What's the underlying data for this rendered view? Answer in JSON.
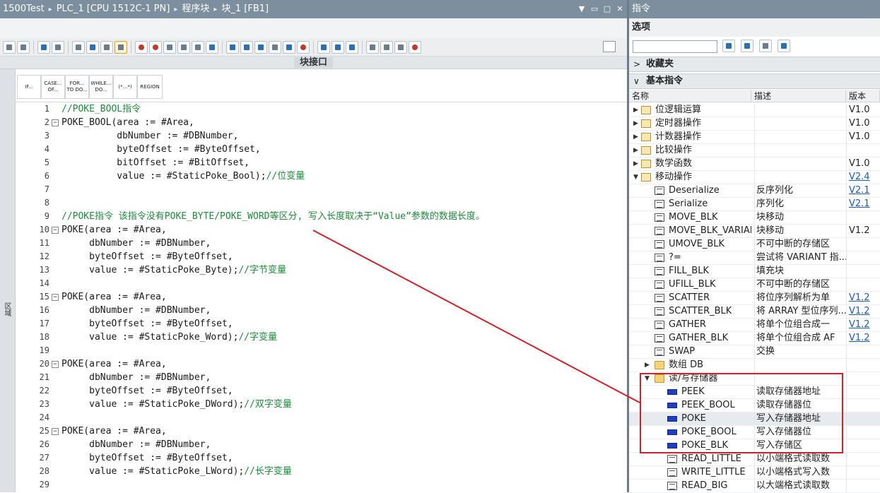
{
  "editor": {
    "breadcrumb": [
      "1500Test",
      "PLC_1 [CPU 1512C-1 PN]",
      "程序块",
      "块_1 [FB1]"
    ],
    "window_controls": [
      "▼",
      "▭",
      "□",
      "✕"
    ],
    "interface_label": "块接口",
    "side_label": "区域",
    "snippets": [
      "IF...",
      "CASE... OF...",
      "FOR... TO DO...",
      "WHILE... DO...",
      "(*...*)",
      "REGION"
    ],
    "lines": [
      {
        "n": "1",
        "fold": "",
        "code": "",
        "comment": "//POKE_BOOL指令"
      },
      {
        "n": "2",
        "fold": "−",
        "code": "POKE_BOOL(area := #Area,",
        "comment": ""
      },
      {
        "n": "3",
        "fold": "",
        "code": "          dbNumber := #DBNumber,",
        "comment": ""
      },
      {
        "n": "4",
        "fold": "",
        "code": "          byteOffset := #ByteOffset,",
        "comment": ""
      },
      {
        "n": "5",
        "fold": "",
        "code": "          bitOffset := #BitOffset,",
        "comment": ""
      },
      {
        "n": "6",
        "fold": "",
        "code": "          value := #StaticPoke_Bool);",
        "comment": "//位变量"
      },
      {
        "n": "7",
        "fold": "",
        "code": "",
        "comment": ""
      },
      {
        "n": "8",
        "fold": "",
        "code": "",
        "comment": ""
      },
      {
        "n": "9",
        "fold": "",
        "code": "",
        "comment": "//POKE指令 该指令没有POKE_BYTE/POKE_WORD等区分, 写入长度取决于“Value”参数的数据长度。"
      },
      {
        "n": "10",
        "fold": "−",
        "code": "POKE(area := #Area,",
        "comment": ""
      },
      {
        "n": "11",
        "fold": "",
        "code": "     dbNumber := #DBNumber,",
        "comment": ""
      },
      {
        "n": "12",
        "fold": "",
        "code": "     byteOffset := #ByteOffset,",
        "comment": ""
      },
      {
        "n": "13",
        "fold": "",
        "code": "     value := #StaticPoke_Byte);",
        "comment": "//字节变量"
      },
      {
        "n": "14",
        "fold": "",
        "code": "",
        "comment": ""
      },
      {
        "n": "15",
        "fold": "−",
        "code": "POKE(area := #Area,",
        "comment": ""
      },
      {
        "n": "16",
        "fold": "",
        "code": "     dbNumber := #DBNumber,",
        "comment": ""
      },
      {
        "n": "17",
        "fold": "",
        "code": "     byteOffset := #ByteOffset,",
        "comment": ""
      },
      {
        "n": "18",
        "fold": "",
        "code": "     value := #StaticPoke_Word);",
        "comment": "//字变量"
      },
      {
        "n": "19",
        "fold": "",
        "code": "",
        "comment": ""
      },
      {
        "n": "20",
        "fold": "−",
        "code": "POKE(area := #Area,",
        "comment": ""
      },
      {
        "n": "21",
        "fold": "",
        "code": "     dbNumber := #DBNumber,",
        "comment": ""
      },
      {
        "n": "22",
        "fold": "",
        "code": "     byteOffset := #ByteOffset,",
        "comment": ""
      },
      {
        "n": "23",
        "fold": "",
        "code": "     value := #StaticPoke_DWord);",
        "comment": "//双字变量"
      },
      {
        "n": "24",
        "fold": "",
        "code": "",
        "comment": ""
      },
      {
        "n": "25",
        "fold": "−",
        "code": "POKE(area := #Area,",
        "comment": ""
      },
      {
        "n": "26",
        "fold": "",
        "code": "     dbNumber := #DBNumber,",
        "comment": ""
      },
      {
        "n": "27",
        "fold": "",
        "code": "     byteOffset := #ByteOffset,",
        "comment": ""
      },
      {
        "n": "28",
        "fold": "",
        "code": "     value := #StaticPoke_LWord);",
        "comment": "//长字变量"
      },
      {
        "n": "29",
        "fold": "",
        "code": "",
        "comment": ""
      }
    ]
  },
  "panel": {
    "title": "指令",
    "options": "选项",
    "search_value": "",
    "favorites": "收藏夹",
    "basic": "基本指令",
    "columns": {
      "name": "名称",
      "desc": "描述",
      "version": "版本"
    },
    "rows": [
      {
        "level": 0,
        "tri": "▶",
        "icon": "grp",
        "name": "位逻辑运算",
        "desc": "",
        "ver": "V1.0",
        "link": false
      },
      {
        "level": 0,
        "tri": "▶",
        "icon": "grp",
        "name": "定时器操作",
        "desc": "",
        "ver": "V1.0",
        "link": false
      },
      {
        "level": 0,
        "tri": "▶",
        "icon": "grp",
        "name": "计数器操作",
        "desc": "",
        "ver": "V1.0",
        "link": false
      },
      {
        "level": 0,
        "tri": "▶",
        "icon": "grp",
        "name": "比较操作",
        "desc": "",
        "ver": "",
        "link": false
      },
      {
        "level": 0,
        "tri": "▶",
        "icon": "grp",
        "name": "数学函数",
        "desc": "",
        "ver": "V1.0",
        "link": false
      },
      {
        "level": 0,
        "tri": "▼",
        "icon": "grp",
        "name": "移动操作",
        "desc": "",
        "ver": "V2.4",
        "link": true
      },
      {
        "level": 1,
        "tri": "",
        "icon": "ins",
        "name": "Deserialize",
        "desc": "反序列化",
        "ver": "V2.1",
        "link": true
      },
      {
        "level": 1,
        "tri": "",
        "icon": "ins",
        "name": "Serialize",
        "desc": "序列化",
        "ver": "V2.1",
        "link": true
      },
      {
        "level": 1,
        "tri": "",
        "icon": "ins",
        "name": "MOVE_BLK",
        "desc": "块移动",
        "ver": "",
        "link": false
      },
      {
        "level": 1,
        "tri": "",
        "icon": "ins",
        "name": "MOVE_BLK_VARIANT",
        "desc": "块移动",
        "ver": "V1.2",
        "link": false
      },
      {
        "level": 1,
        "tri": "",
        "icon": "ins",
        "name": "UMOVE_BLK",
        "desc": "不可中断的存储区",
        "ver": "",
        "link": false
      },
      {
        "level": 1,
        "tri": "",
        "icon": "ins",
        "name": "?=",
        "desc": "尝试将 VARIANT 指...",
        "ver": "",
        "link": false
      },
      {
        "level": 1,
        "tri": "",
        "icon": "ins",
        "name": "FILL_BLK",
        "desc": "填充块",
        "ver": "",
        "link": false
      },
      {
        "level": 1,
        "tri": "",
        "icon": "ins",
        "name": "UFILL_BLK",
        "desc": "不可中断的存储区",
        "ver": "",
        "link": false
      },
      {
        "level": 1,
        "tri": "",
        "icon": "ins",
        "name": "SCATTER",
        "desc": "将位序列解析为单",
        "ver": "V1.2",
        "link": true
      },
      {
        "level": 1,
        "tri": "",
        "icon": "ins",
        "name": "SCATTER_BLK",
        "desc": "将 ARRAY 型位序列...",
        "ver": "V1.2",
        "link": true
      },
      {
        "level": 1,
        "tri": "",
        "icon": "ins",
        "name": "GATHER",
        "desc": "将单个位组合成一",
        "ver": "V1.2",
        "link": true
      },
      {
        "level": 1,
        "tri": "",
        "icon": "ins",
        "name": "GATHER_BLK",
        "desc": "将单个位组合成 AF",
        "ver": "V1.2",
        "link": true
      },
      {
        "level": 1,
        "tri": "",
        "icon": "ins",
        "name": "SWAP",
        "desc": "交换",
        "ver": "",
        "link": false
      },
      {
        "level": 1,
        "tri": "▶",
        "icon": "fold",
        "name": "数组 DB",
        "desc": "",
        "ver": "",
        "link": false
      },
      {
        "level": 1,
        "tri": "▼",
        "icon": "fold",
        "name": "读/写存储器",
        "desc": "",
        "ver": "",
        "link": false
      },
      {
        "level": 2,
        "tri": "",
        "icon": "blue",
        "name": "PEEK",
        "desc": "读取存储器地址",
        "ver": "",
        "link": false
      },
      {
        "level": 2,
        "tri": "",
        "icon": "blue",
        "name": "PEEK_BOOL",
        "desc": "读取存储器位",
        "ver": "",
        "link": false
      },
      {
        "level": 2,
        "tri": "",
        "icon": "blue",
        "name": "POKE",
        "desc": "写入存储器地址",
        "ver": "",
        "link": false
      },
      {
        "level": 2,
        "tri": "",
        "icon": "blue",
        "name": "POKE_BOOL",
        "desc": "写入存储器位",
        "ver": "",
        "link": false
      },
      {
        "level": 2,
        "tri": "",
        "icon": "blue",
        "name": "POKE_BLK",
        "desc": "写入存储区",
        "ver": "",
        "link": false
      },
      {
        "level": 2,
        "tri": "",
        "icon": "ins",
        "name": "READ_LITTLE",
        "desc": "以小端格式读取数",
        "ver": "",
        "link": false
      },
      {
        "level": 2,
        "tri": "",
        "icon": "ins",
        "name": "WRITE_LITTLE",
        "desc": "以小端格式写入数",
        "ver": "",
        "link": false
      },
      {
        "level": 2,
        "tri": "",
        "icon": "ins",
        "name": "READ_BIG",
        "desc": "以大端格式读取数",
        "ver": "",
        "link": false
      }
    ],
    "highlight_row": "POKE"
  },
  "annotation": {
    "highlight_color": "#d0202a"
  }
}
